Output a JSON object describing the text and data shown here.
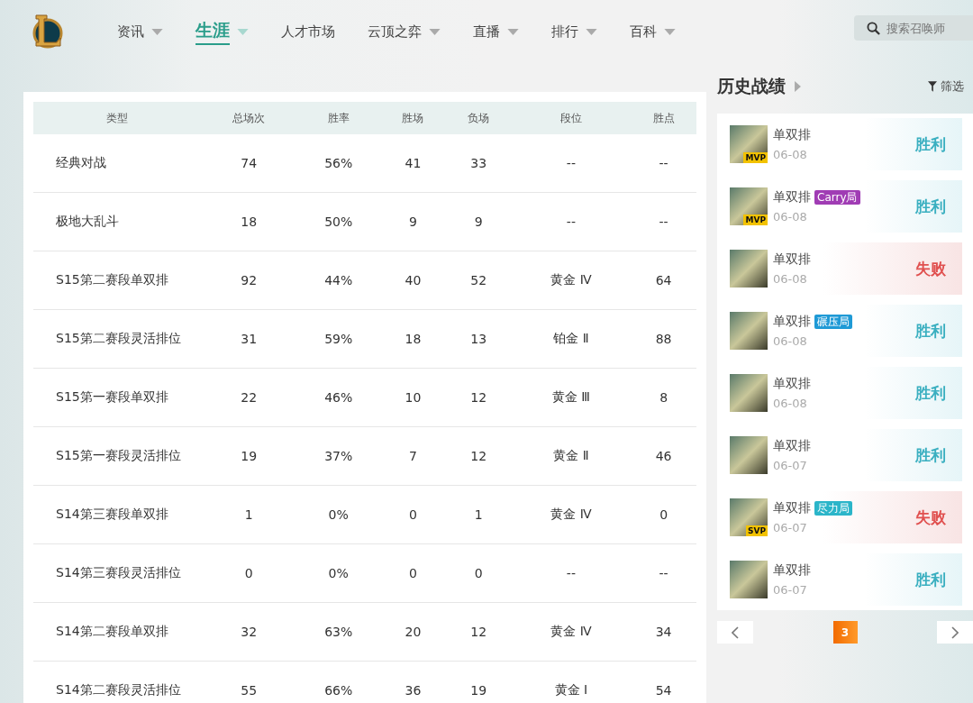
{
  "nav": [
    {
      "label": "资讯",
      "dropdown": true,
      "selected": false
    },
    {
      "label": "生涯",
      "dropdown": true,
      "selected": true
    },
    {
      "label": "人才市场",
      "dropdown": false,
      "selected": false
    },
    {
      "label": "云顶之弈",
      "dropdown": true,
      "selected": false
    },
    {
      "label": "直播",
      "dropdown": true,
      "selected": false
    },
    {
      "label": "排行",
      "dropdown": true,
      "selected": false
    },
    {
      "label": "百科",
      "dropdown": true,
      "selected": false
    }
  ],
  "search": {
    "placeholder": "搜索召唤师"
  },
  "table": {
    "columns": [
      "类型",
      "总场次",
      "胜率",
      "胜场",
      "负场",
      "段位",
      "胜点"
    ],
    "rows": [
      [
        "经典对战",
        "74",
        "56%",
        "41",
        "33",
        "--",
        "--"
      ],
      [
        "极地大乱斗",
        "18",
        "50%",
        "9",
        "9",
        "--",
        "--"
      ],
      [
        "S15第二赛段单双排",
        "92",
        "44%",
        "40",
        "52",
        "黄金 Ⅳ",
        "64"
      ],
      [
        "S15第二赛段灵活排位",
        "31",
        "59%",
        "18",
        "13",
        "铂金 Ⅱ",
        "88"
      ],
      [
        "S15第一赛段单双排",
        "22",
        "46%",
        "10",
        "12",
        "黄金 Ⅲ",
        "8"
      ],
      [
        "S15第一赛段灵活排位",
        "19",
        "37%",
        "7",
        "12",
        "黄金 Ⅱ",
        "46"
      ],
      [
        "S14第三赛段单双排",
        "1",
        "0%",
        "0",
        "1",
        "黄金 Ⅳ",
        "0"
      ],
      [
        "S14第三赛段灵活排位",
        "0",
        "0%",
        "0",
        "0",
        "--",
        "--"
      ],
      [
        "S14第二赛段单双排",
        "32",
        "63%",
        "20",
        "12",
        "黄金 Ⅳ",
        "34"
      ],
      [
        "S14第二赛段灵活排位",
        "55",
        "66%",
        "36",
        "19",
        "黄金 Ⅰ",
        "54"
      ]
    ]
  },
  "history": {
    "title": "历史战绩",
    "filter": "筛选",
    "matches": [
      {
        "mode": "单双排",
        "date": "06-08",
        "badge": "MVP",
        "result": "胜利",
        "kind": "win"
      },
      {
        "mode": "单双排",
        "tag": "Carry局",
        "color": "#a03cb4",
        "date": "06-08",
        "badge": "MVP",
        "result": "胜利",
        "kind": "win"
      },
      {
        "mode": "单双排",
        "date": "06-08",
        "result": "失败",
        "kind": "loss"
      },
      {
        "mode": "单双排",
        "tag": "碾压局",
        "color": "#1f9ad6",
        "date": "06-08",
        "result": "胜利",
        "kind": "win"
      },
      {
        "mode": "单双排",
        "date": "06-08",
        "result": "胜利",
        "kind": "win"
      },
      {
        "mode": "单双排",
        "date": "06-07",
        "result": "胜利",
        "kind": "win"
      },
      {
        "mode": "单双排",
        "tag": "尽力局",
        "color": "#2bb5c9",
        "date": "06-07",
        "badge": "SVP",
        "result": "失败",
        "kind": "loss"
      },
      {
        "mode": "单双排",
        "date": "06-07",
        "result": "胜利",
        "kind": "win"
      }
    ],
    "page": "3"
  }
}
